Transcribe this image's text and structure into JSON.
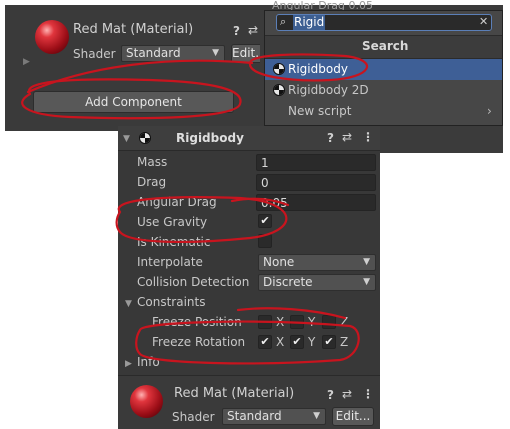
{
  "top_inspector": {
    "material_title": "Red Mat (Material)",
    "shader_label": "Shader",
    "shader_value": "Standard",
    "edit_button": "Edit...",
    "add_component_button": "Add Component",
    "background_partial_text": "Angular Drag  0.05"
  },
  "component_search": {
    "search_value": "Rigid",
    "header": "Search",
    "items": [
      {
        "label": "Rigidbody",
        "icon": "rigidbody-icon"
      },
      {
        "label": "Rigidbody 2D",
        "icon": "rigidbody-icon"
      },
      {
        "label": "New script",
        "icon": "chevron-right-icon"
      }
    ]
  },
  "rigidbody": {
    "title": "Rigidbody",
    "mass_label": "Mass",
    "mass_value": "1",
    "drag_label": "Drag",
    "drag_value": "0",
    "angular_drag_label": "Angular Drag",
    "angular_drag_value": "0.05",
    "use_gravity_label": "Use Gravity",
    "use_gravity_checked": true,
    "is_kinematic_label": "Is Kinematic",
    "is_kinematic_checked": false,
    "interpolate_label": "Interpolate",
    "interpolate_value": "None",
    "collision_label": "Collision Detection",
    "collision_value": "Discrete",
    "constraints_label": "Constraints",
    "freeze_position_label": "Freeze Position",
    "freeze_rotation_label": "Freeze Rotation",
    "axis_x": "X",
    "axis_y": "Y",
    "axis_z": "Z",
    "freeze_position": {
      "x": false,
      "y": false,
      "z": false
    },
    "freeze_rotation": {
      "x": true,
      "y": true,
      "z": true
    },
    "info_label": "Info",
    "check_glyph": "✔"
  },
  "bottom_material": {
    "material_title": "Red Mat (Material)",
    "shader_label": "Shader",
    "shader_value": "Standard",
    "edit_button": "Edit..."
  },
  "colors": {
    "panel": "#383838",
    "selection": "#3e5f96",
    "annotation": "#c8141e"
  }
}
